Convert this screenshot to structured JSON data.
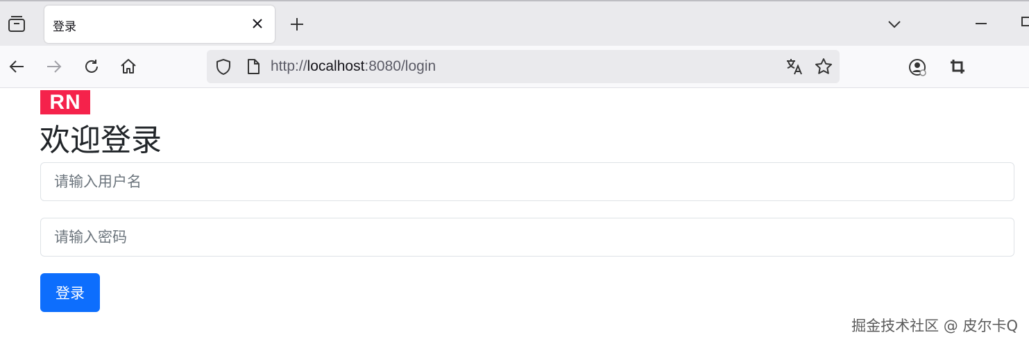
{
  "browser": {
    "tab_title": "登录",
    "url_prefix": "http://",
    "url_host": "localhost",
    "url_rest": ":8080/login"
  },
  "page": {
    "logo_text": "RN",
    "heading": "欢迎登录",
    "username_placeholder": "请输入用户名",
    "password_placeholder": "请输入密码",
    "login_button": "登录",
    "watermark": "掘金技术社区 @ 皮尔卡Q"
  },
  "colors": {
    "logo_bg": "#f5224b",
    "button_bg": "#0d6efd"
  },
  "icons": [
    "tab-overview-icon",
    "close-icon",
    "plus-icon",
    "chevron-down-icon",
    "minimize-icon",
    "maximize-icon",
    "back-arrow-icon",
    "forward-arrow-icon",
    "reload-icon",
    "home-icon",
    "shield-icon",
    "page-icon",
    "translate-icon",
    "star-icon",
    "account-icon",
    "crop-icon"
  ]
}
